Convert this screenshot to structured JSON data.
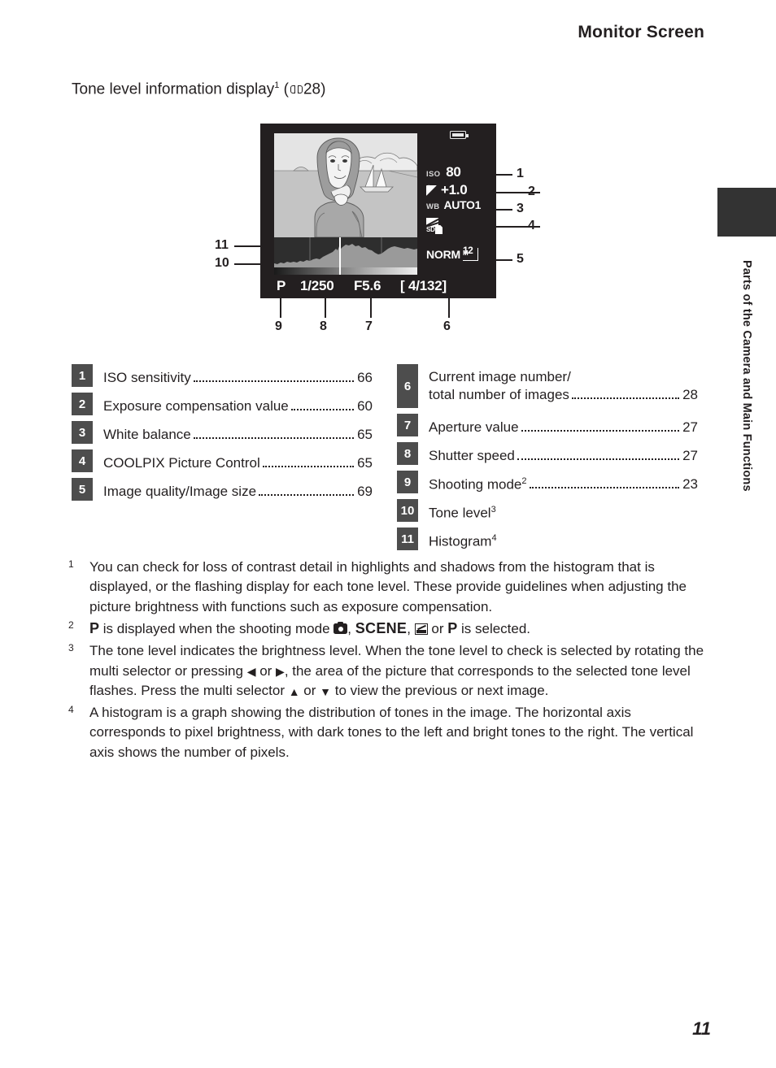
{
  "header": {
    "title": "Monitor Screen"
  },
  "section": {
    "heading": "Tone level information display",
    "heading_sup": "1",
    "ref_icon": "book-icon",
    "ref_page": "28",
    "open_paren": "(",
    "close_paren": ")"
  },
  "chapter_tab": {
    "label": "Parts of the Camera and Main Functions",
    "color": "#333333"
  },
  "monitor": {
    "battery_icon": "battery-icon",
    "iso_label": "ISO",
    "iso_value": "80",
    "ev_icon": "exposure-compensation-icon",
    "ev_value": "+1.0",
    "wb_label": "WB",
    "wb_value": "AUTO1",
    "picture_control_icon": "coolpix-picture-control-icon",
    "quality_label": "NORM",
    "size_value": "12",
    "size_unit": "M",
    "shooting_mode": "P",
    "shutter_speed": "1/250",
    "aperture": "F5.6",
    "frame_counter": "[  4/132]"
  },
  "callouts": {
    "n1": "1",
    "n2": "2",
    "n3": "3",
    "n4": "4",
    "n5": "5",
    "n6": "6",
    "n7": "7",
    "n8": "8",
    "n9": "9",
    "n10": "10",
    "n11": "11"
  },
  "legend_left": [
    {
      "num": "1",
      "text": "ISO sensitivity",
      "page": "66"
    },
    {
      "num": "2",
      "text": "Exposure compensation value",
      "page": "60"
    },
    {
      "num": "3",
      "text": "White balance",
      "page": "65"
    },
    {
      "num": "4",
      "text": "COOLPIX Picture Control",
      "page": "65"
    },
    {
      "num": "5",
      "text": "Image quality/Image size",
      "page": "69"
    }
  ],
  "legend_right": [
    {
      "num": "6",
      "text_line1": "Current image number/",
      "text": "total number of images",
      "page": "28"
    },
    {
      "num": "7",
      "text": "Aperture value",
      "page": "27"
    },
    {
      "num": "8",
      "text": "Shutter speed",
      "page": "27"
    },
    {
      "num": "9",
      "text": "Shooting mode",
      "sup": "2",
      "page": "23"
    },
    {
      "num": "10",
      "text": "Tone level",
      "sup": "3",
      "page": ""
    },
    {
      "num": "11",
      "text": "Histogram",
      "sup": "4",
      "page": ""
    }
  ],
  "footnotes": {
    "n1_marker": "1",
    "n1_text": "You can check for loss of contrast detail in highlights and shadows from the histogram that is displayed, or the flashing display for each tone level. These provide guidelines when adjusting the picture brightness with functions such as exposure compensation.",
    "n2_marker": "2",
    "n2_part1": " is displayed when the shooting mode ",
    "n2_icon_camera": "auto-mode-icon",
    "n2_comma1": ", ",
    "n2_scene": "SCENE",
    "n2_comma2": ", ",
    "n2_icon_effects": "special-effects-icon",
    "n2_part2": " or ",
    "n2_mode_p": "P",
    "n2_part3": " is selected.",
    "n3_marker": "3",
    "n3_part1": "The tone level indicates the brightness level. When the tone level to check is selected by rotating the multi selector or pressing ",
    "n3_left_arrow": "◀",
    "n3_part2": " or ",
    "n3_right_arrow": "▶",
    "n3_part3": ", the area of the picture that corresponds to the selected tone level flashes. Press the multi selector ",
    "n3_up_arrow": "▲",
    "n3_part4": " or ",
    "n3_down_arrow": "▼",
    "n3_part5": " to view the previous or next image.",
    "n4_marker": "4",
    "n4_text": "A histogram is a graph showing the distribution of tones in the image. The horizontal axis corresponds to pixel brightness, with dark tones to the left and bright tones to the right. The vertical axis shows the number of pixels."
  },
  "page_number": "11"
}
